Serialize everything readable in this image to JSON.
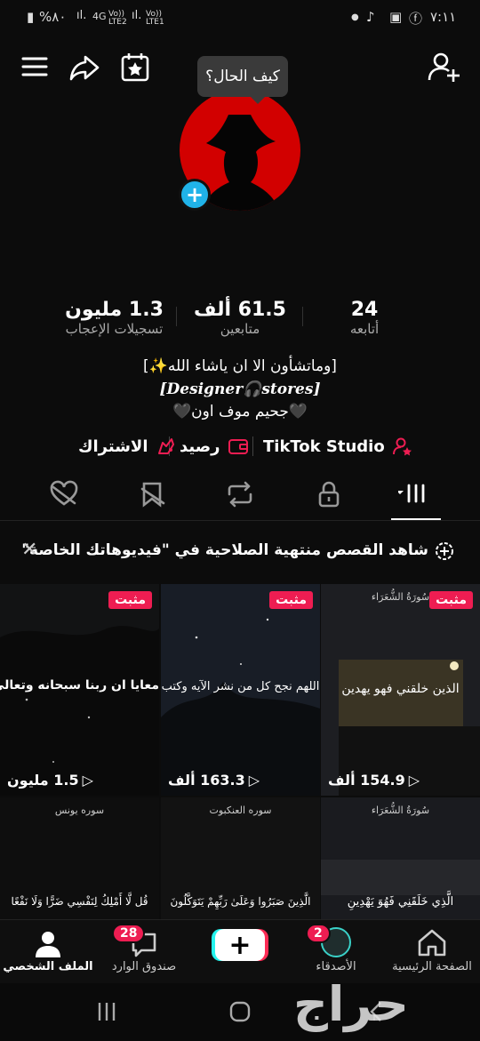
{
  "status_bar": {
    "battery": "%٨٠",
    "network1": "4G",
    "lte2": "Vo)) LTE2",
    "lte1": "Vo)) LTE1",
    "time": "٧:١١"
  },
  "profile": {
    "tooltip": "كيف الحال؟",
    "stats": [
      {
        "value": "24",
        "label": "أتابعه"
      },
      {
        "value": "61.5 ألف",
        "label": "متابعين"
      },
      {
        "value": "1.3 مليون",
        "label": "تسجيلات الإعجاب"
      }
    ],
    "bio_lines": [
      "[وماتشأون الا ان ياشاء الله✨]",
      "[Designer🎧stores]",
      "🖤جحيم موف اون🖤"
    ],
    "tools": {
      "studio": "TikTok Studio",
      "balance": "رصيد",
      "subscription": "الاشتراك"
    }
  },
  "banner": {
    "text": "شاهد القصص منتهية الصلاحية في \"فيديوهاتك الخاصة\""
  },
  "videos": [
    {
      "pinned": "مثبت",
      "caption": "الذين خلقني فهو يهدين",
      "top_label": "سُورَةُ الشُّعَرَاء",
      "views": "154.9 ألف",
      "bg": "#1d1e22"
    },
    {
      "pinned": "مثبت",
      "caption": "اللهم نجح كل من نشر الآيه وكتب",
      "top_label": "",
      "views": "163.3 ألف",
      "bg": "#181d26"
    },
    {
      "pinned": "مثبت",
      "caption": "معايا ان ربنا سبحانه وتعالى باسط",
      "top_label": "",
      "views": "1.5 مليون",
      "bg": "#121314"
    },
    {
      "pinned": "",
      "caption": "الَّذِي خَلَقَنِي فَهُوَ يَهْدِينِ",
      "top_label": "سُورَةُ الشُّعَرَاء",
      "views": "",
      "bg": "#1a1b1f"
    },
    {
      "pinned": "",
      "caption": "الَّذِينَ صَبَرُوا وَعَلَىٰ رَبِّهِمْ يَتَوَكَّلُونَ",
      "top_label": "سوره العنكبوت",
      "views": "",
      "bg": "#121212"
    },
    {
      "pinned": "",
      "caption": "قُل لَّا أَمْلِكُ لِنَفْسِي ضَرًّا وَلَا نَفْعًا",
      "top_label": "سوره يونس",
      "views": "",
      "bg": "#0e0e0e"
    }
  ],
  "nav": {
    "home": "الصفحة الرئيسية",
    "friends": "الأصدقاء",
    "friends_badge": "2",
    "inbox": "صندوق الوارد",
    "inbox_badge": "28",
    "profile": "الملف الشخصي"
  },
  "watermark": "حراج",
  "colors": {
    "accent": "#ee1d52",
    "avatar_bg": "#d20000",
    "add_button": "#20b3e9"
  }
}
